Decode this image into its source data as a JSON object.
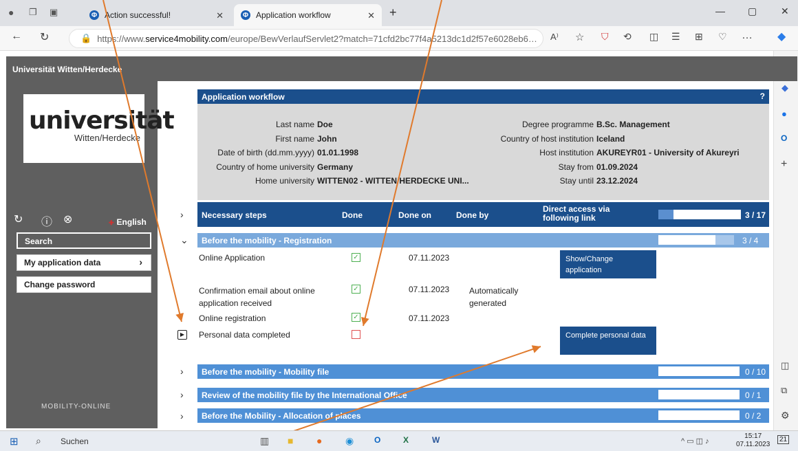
{
  "browser": {
    "tabs": [
      {
        "label": "Action successful!"
      },
      {
        "label": "Application workflow"
      }
    ],
    "url_prefix": "https://www.",
    "url_domain": "service4mobility.com",
    "url_path": "/europe/BewVerlaufServlet2?match=71cfd2bc77f4a5213dc1d2f57e6028eb6…"
  },
  "app": {
    "header_title": "Universität Witten/Herdecke",
    "logo_text": "universität",
    "logo_sub": "Witten/Herdecke",
    "language": "English",
    "nav": {
      "search": "Search",
      "my_application": "My application data",
      "change_password": "Change password"
    },
    "brand_footer": "MOBILITY-ONLINE"
  },
  "workflow": {
    "title": "Application workflow",
    "info_left": [
      {
        "label": "Last name",
        "value": "Doe"
      },
      {
        "label": "First name",
        "value": "John"
      },
      {
        "label": "Date of birth (dd.mm.yyyy)",
        "value": "01.01.1998"
      },
      {
        "label": "Country of home university",
        "value": "Germany"
      },
      {
        "label": "Home university",
        "value": "WITTEN02 - WITTEN/HERDECKE UNI..."
      }
    ],
    "info_right": [
      {
        "label": "Degree programme",
        "value": "B.Sc. Management"
      },
      {
        "label": "Country of host institution",
        "value": "Iceland"
      },
      {
        "label": "Host institution",
        "value": "AKUREYR01 - University of Akureyri"
      },
      {
        "label": "Stay from",
        "value": "01.09.2024"
      },
      {
        "label": "Stay until",
        "value": "23.12.2024"
      }
    ],
    "columns": {
      "steps": "Necessary steps",
      "done": "Done",
      "done_on": "Done on",
      "done_by": "Done by",
      "link": "Direct access via following link",
      "count": "3 / 17"
    },
    "total_progress": 0.18,
    "section1": {
      "title": "Before the mobility - Registration",
      "count": "3 / 4",
      "progress": 0.75
    },
    "steps": [
      {
        "name": "Online Application",
        "done": true,
        "date": "07.11.2023",
        "by": "",
        "button": "Show/Change application"
      },
      {
        "name": "Confirmation email about online application received",
        "done": true,
        "date": "07.11.2023",
        "by": "Automatically generated",
        "button": ""
      },
      {
        "name": "Online registration",
        "done": true,
        "date": "07.11.2023",
        "by": "",
        "button": ""
      },
      {
        "name": "Personal data completed",
        "done": false,
        "date": "",
        "by": "",
        "button": "Complete personal data"
      }
    ],
    "sections": [
      {
        "title": "Before the mobility - Mobility file",
        "count": "0 / 10"
      },
      {
        "title": "Review of the mobility file by the International Office",
        "count": "0 / 1"
      },
      {
        "title": "Before the Mobility - Allocation of places",
        "count": "0 / 2"
      }
    ]
  },
  "taskbar": {
    "search": "Suchen",
    "time": "15:17",
    "date": "07.11.2023",
    "notif": "21"
  },
  "colors": {
    "primary": "#1b4f8c",
    "section_light": "#7aa9dc",
    "panel": "#5f5f5f",
    "arrow": "#e07a2c"
  }
}
